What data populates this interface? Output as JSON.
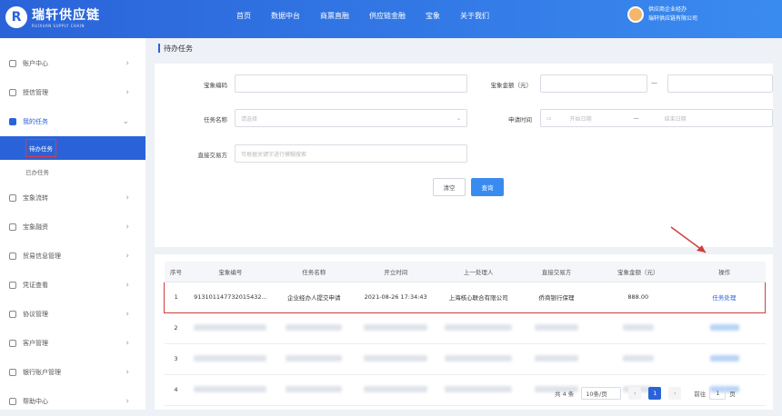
{
  "brand": {
    "mark": "R",
    "title": "瑞轩供应链",
    "subtitle": "RUIXUAN SUPPLY CHAIN"
  },
  "topnav": [
    "首页",
    "数据中台",
    "商票直融",
    "供应链金融",
    "宝象",
    "关于我们"
  ],
  "user": {
    "line1": "供应商企业经办",
    "line2": "瑞轩供应链有限公司"
  },
  "sidebar": {
    "items": [
      {
        "label": "账户中心"
      },
      {
        "label": "授信管理"
      },
      {
        "label": "我的任务"
      },
      {
        "label": "宝象流转"
      },
      {
        "label": "宝象融资"
      },
      {
        "label": "贸易信息管理"
      },
      {
        "label": "凭证查看"
      },
      {
        "label": "协议管理"
      },
      {
        "label": "客户管理"
      },
      {
        "label": "银行账户管理"
      },
      {
        "label": "帮助中心"
      }
    ],
    "sub": [
      {
        "label": "待办任务"
      },
      {
        "label": "已办任务"
      }
    ]
  },
  "page_title": "待办任务",
  "filter": {
    "code_label": "宝象编码",
    "amount_label": "宝象金额（元）",
    "task_label": "任务名称",
    "task_placeholder": "请选择",
    "apply_label": "申请时间",
    "start_placeholder": "开始日期",
    "end_placeholder": "结束日期",
    "counterparty_label": "直接交易方",
    "counterparty_placeholder": "可根据关键字进行模糊搜索",
    "dash": "—",
    "clear": "清空",
    "query": "查询"
  },
  "table": {
    "headers": [
      "序号",
      "宝象编号",
      "任务名称",
      "开立时间",
      "上一处理人",
      "直接交易方",
      "宝象金额（元）",
      "操作"
    ],
    "row1": {
      "no": "1",
      "code": "913101147732015432...",
      "task": "企业经办人提交申请",
      "time": "2021-08-26 17:34:43",
      "prev": "上海核心联合有限公司",
      "party": "侨商银行保理",
      "amount": "888.00",
      "action": "任务处理"
    },
    "blurred_rows": [
      "2",
      "3",
      "4"
    ]
  },
  "pager": {
    "total": "共 4 条",
    "size": "10条/页",
    "current": "1",
    "goto": "前往",
    "goto_page": "1",
    "page_unit": "页",
    "prev": "‹",
    "next": "›"
  },
  "colors": {
    "primary": "#2a63d9",
    "highlight": "#d23c3c"
  }
}
